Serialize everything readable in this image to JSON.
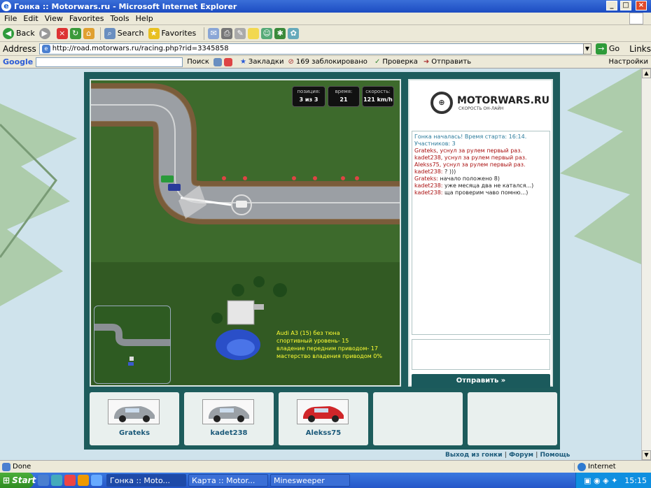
{
  "window": {
    "title": "Гонка :: Motorwars.ru - Microsoft Internet Explorer"
  },
  "menu": [
    "File",
    "Edit",
    "View",
    "Favorites",
    "Tools",
    "Help"
  ],
  "toolbar": {
    "back": "Back",
    "search": "Search",
    "favorites": "Favorites"
  },
  "address": {
    "label": "Address",
    "url": "http://road.motorwars.ru/racing.php?rid=3345858",
    "go": "Go",
    "links": "Links"
  },
  "google": {
    "label": "Google",
    "search": "Поиск",
    "bookmarks": "Закладки",
    "blocked": "169 заблокировано",
    "check": "Проверка",
    "send": "Отправить",
    "settings": "Настройки"
  },
  "hud": [
    {
      "label": "позиция:",
      "value": "3 из 3"
    },
    {
      "label": "время:",
      "value": "21"
    },
    {
      "label": "скорость:",
      "value": "121 km/h"
    }
  ],
  "info": [
    "Audi A3 (15) без тюна",
    "спортивный уровень- 15",
    "владение передним приводом- 17",
    "мастерство владения приводом 0%"
  ],
  "logo": {
    "name": "MOTORWARS.RU",
    "tagline": "СКОРОСТЬ ОН-ЛАЙН"
  },
  "chat": [
    {
      "cls": "sys",
      "text": "Гонка началась! Время старта: 16:14. Участников: 3"
    },
    {
      "cls": "red",
      "text": "Grateks, уснул за рулем первый раз."
    },
    {
      "cls": "red",
      "text": "kadet238, уснул за рулем первый раз."
    },
    {
      "cls": "red",
      "text": "Alekss75, уснул за рулем первый раз."
    },
    {
      "cls": "blk",
      "user": "kadet238:",
      "text": " ? )))"
    },
    {
      "cls": "blk",
      "user": "Grateks:",
      "text": " начало положено 8)"
    },
    {
      "cls": "blk",
      "user": "kadet238:",
      "text": " уже месяца два не катался...)"
    },
    {
      "cls": "blk",
      "user": "kadet238:",
      "text": " ща проверим чаво помню...)"
    }
  ],
  "send_button": "Отправить »",
  "players": [
    {
      "name": "Grateks",
      "car_color": "#9aa0a6"
    },
    {
      "name": "kadet238",
      "car_color": "#9aa0a6"
    },
    {
      "name": "Alekss75",
      "car_color": "#d0262a"
    },
    {
      "name": "",
      "car_color": ""
    },
    {
      "name": "",
      "car_color": ""
    }
  ],
  "footer": {
    "exit": "Выход из гонки",
    "forum": "Форум",
    "help": "Помощь",
    "sep": "|"
  },
  "status": {
    "text": "Done",
    "zone": "Internet"
  },
  "taskbar": {
    "start": "Start",
    "tasks": [
      "Гонка :: Moto...",
      "Карта :: Motor...",
      "Minesweeper"
    ],
    "clock": "15:15"
  }
}
